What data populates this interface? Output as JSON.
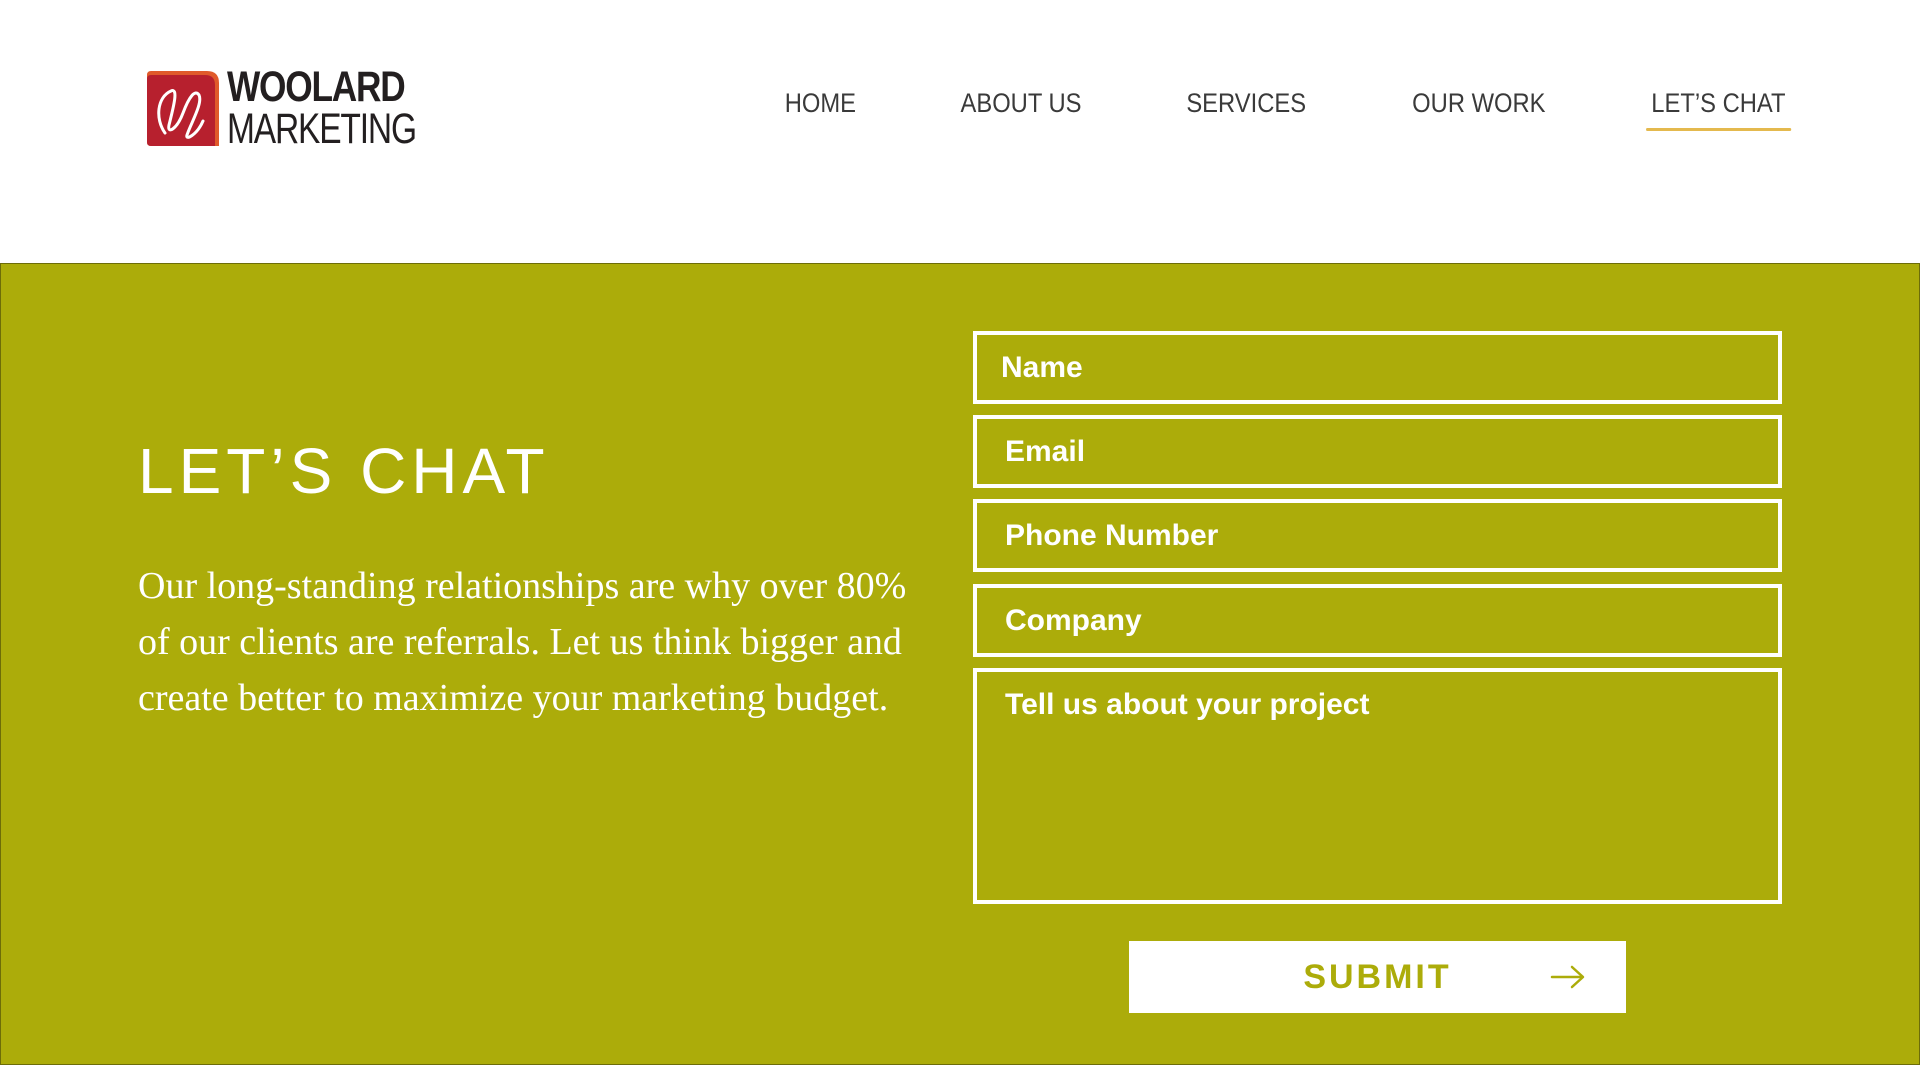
{
  "brand": {
    "name_line1": "WOOLARD",
    "name_line2": "MARKETING",
    "logo_icon": "woolard-w-monogram"
  },
  "nav": {
    "items": [
      {
        "label": "HOME",
        "active": false
      },
      {
        "label": "ABOUT US",
        "active": false
      },
      {
        "label": "SERVICES",
        "active": false
      },
      {
        "label": "OUR WORK",
        "active": false
      },
      {
        "label": "LET’S CHAT",
        "active": true
      }
    ]
  },
  "contact": {
    "title": "LET’S CHAT",
    "body": "Our long-standing relationships are why over 80% of our clients are referrals. Let us think bigger and create better to maximize your marketing budget."
  },
  "form": {
    "name_placeholder": "Name",
    "email_placeholder": "Email",
    "phone_placeholder": "Phone Number",
    "company_placeholder": "Company",
    "project_placeholder": "Tell us about your project",
    "submit_label": "SUBMIT",
    "submit_icon": "arrow-right-icon"
  },
  "colors": {
    "section_background": "#acac0a",
    "nav_underline": "#e4b94e",
    "logo_red": "#b7202e",
    "logo_orange": "#e05a2b",
    "text_dark": "#231f20"
  }
}
